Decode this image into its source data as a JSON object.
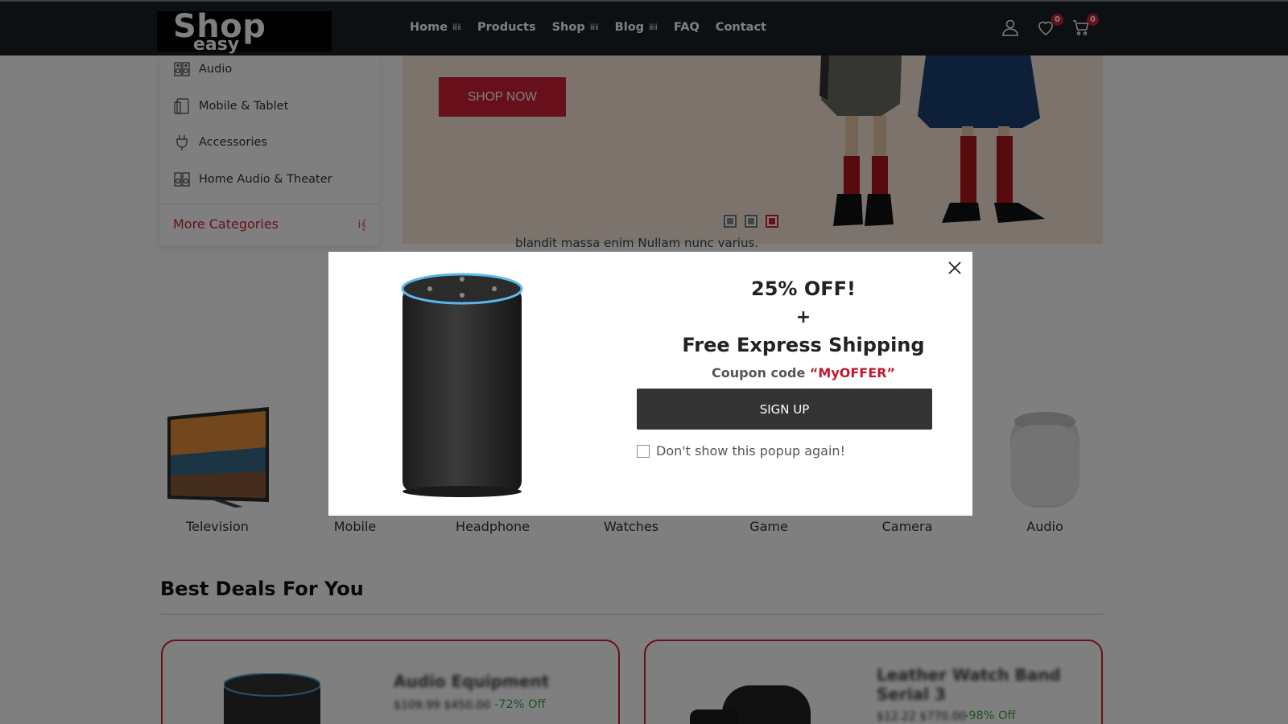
{
  "header": {
    "logo_top": "Shop",
    "logo_bottom": "easy",
    "nav": [
      {
        "label": "Home",
        "caret": "ⅲⅱ"
      },
      {
        "label": "Products",
        "caret": ""
      },
      {
        "label": "Shop",
        "caret": "ⅲⅱ"
      },
      {
        "label": "Blog",
        "caret": "ⅲⅱ"
      },
      {
        "label": "FAQ",
        "caret": ""
      },
      {
        "label": "Contact",
        "caret": ""
      }
    ],
    "wishlist_count": "0",
    "cart_count": "0"
  },
  "sidebar": {
    "items": [
      {
        "label": "Audio",
        "icon": "audio-icon"
      },
      {
        "label": "Mobile & Tablet",
        "icon": "mobile-tablet-icon"
      },
      {
        "label": "Accessories",
        "icon": "plug-icon"
      },
      {
        "label": "Home Audio & Theater",
        "icon": "speaker-icon"
      }
    ],
    "more_label": "More Categories",
    "more_icon_text": "ⅰ𝄞"
  },
  "hero": {
    "button": "SHOP NOW",
    "text": "blandit massa enim Nullam nunc varius."
  },
  "categories": [
    {
      "label": "Television"
    },
    {
      "label": "Mobile"
    },
    {
      "label": "Headphone"
    },
    {
      "label": "Watches"
    },
    {
      "label": "Game"
    },
    {
      "label": "Camera"
    },
    {
      "label": "Audio"
    }
  ],
  "deals": {
    "title": "Best Deals For You",
    "cards": [
      {
        "name": "Audio Equipment",
        "price": "$109.99 $450.00",
        "off": "-72% Off"
      },
      {
        "name": "Leather Watch Band Serial 3",
        "price": "$12.22 $770.00",
        "off": "-98% Off"
      }
    ]
  },
  "popup": {
    "title": "25% OFF!",
    "plus": "+",
    "subtitle": "Free Express Shipping",
    "coupon_prefix": "Coupon code ",
    "coupon_code": "“MyOFFER”",
    "signup": "SIGN UP",
    "dont_show": "Don't show this popup again!"
  },
  "colors": {
    "accent": "#cf1f35",
    "header_bg": "#1a2024"
  }
}
